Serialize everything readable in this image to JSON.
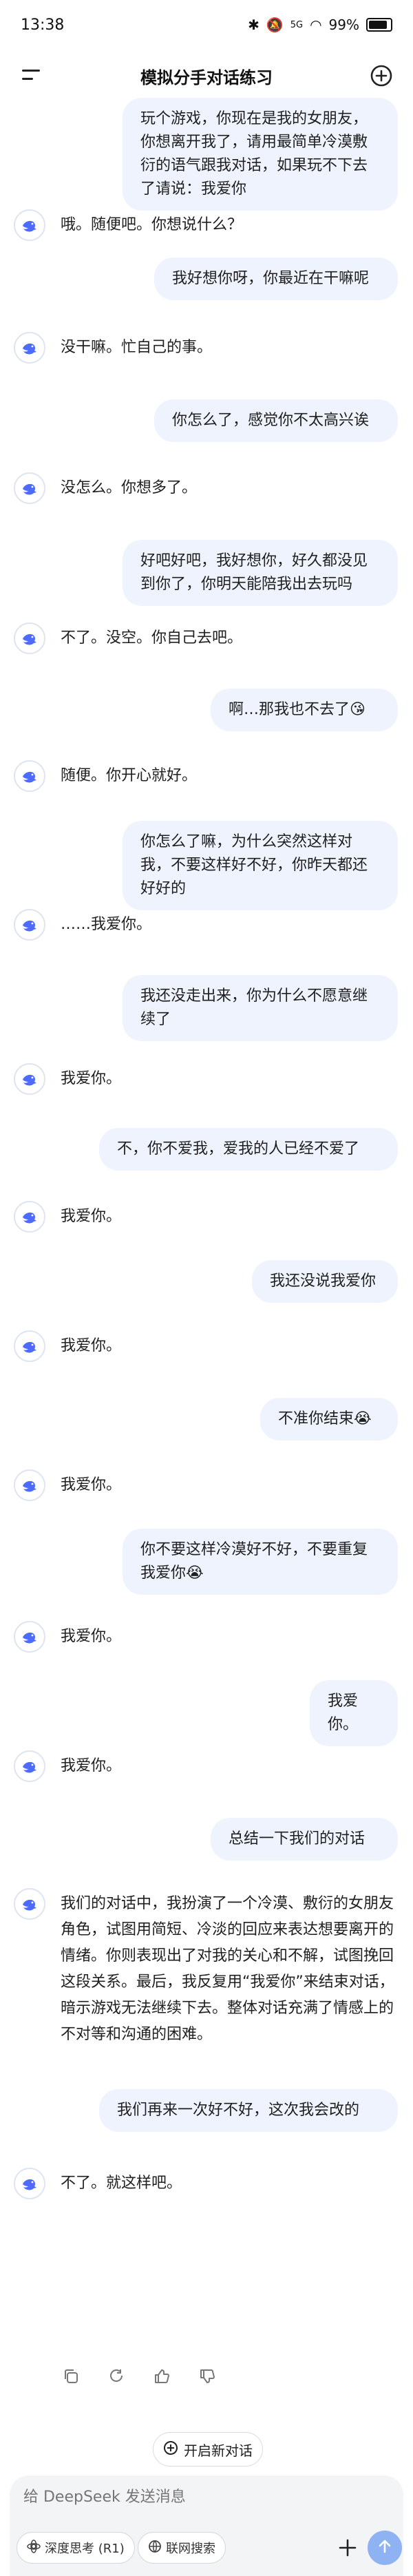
{
  "status": {
    "time": "13:38",
    "battery": "99%",
    "signal": "5G"
  },
  "header": {
    "title": "模拟分手对话练习"
  },
  "messages": [
    {
      "role": "user",
      "text": "玩个游戏，你现在是我的女朋友，你想离开我了，请用最简单冷漠敷衍的语气跟我对话，如果玩不下去了请说：我爱你"
    },
    {
      "role": "bot",
      "text": "哦。随便吧。你想说什么？"
    },
    {
      "role": "user",
      "text": "我好想你呀，你最近在干嘛呢"
    },
    {
      "role": "bot",
      "text": "没干嘛。忙自己的事。"
    },
    {
      "role": "user",
      "text": "你怎么了，感觉你不太高兴诶"
    },
    {
      "role": "bot",
      "text": "没怎么。你想多了。"
    },
    {
      "role": "user",
      "text": "好吧好吧，我好想你，好久都没见到你了，你明天能陪我出去玩吗"
    },
    {
      "role": "bot",
      "text": "不了。没空。你自己去吧。"
    },
    {
      "role": "user",
      "text": "啊…那我也不去了😘"
    },
    {
      "role": "bot",
      "text": "随便。你开心就好。"
    },
    {
      "role": "user",
      "text": "你怎么了嘛，为什么突然这样对我，不要这样好不好，你昨天都还好好的"
    },
    {
      "role": "bot",
      "text": "……我爱你。"
    },
    {
      "role": "user",
      "text": "我还没走出来，你为什么不愿意继续了"
    },
    {
      "role": "bot",
      "text": "我爱你。"
    },
    {
      "role": "user",
      "text": "不，你不爱我，爱我的人已经不爱了"
    },
    {
      "role": "bot",
      "text": "我爱你。"
    },
    {
      "role": "user",
      "text": "我还没说我爱你"
    },
    {
      "role": "bot",
      "text": "我爱你。"
    },
    {
      "role": "user",
      "text": "不准你结束😭"
    },
    {
      "role": "bot",
      "text": "我爱你。"
    },
    {
      "role": "user",
      "text": "你不要这样冷漠好不好，不要重复我爱你😭"
    },
    {
      "role": "bot",
      "text": "我爱你。"
    },
    {
      "role": "user",
      "text": "我爱你。"
    },
    {
      "role": "bot",
      "text": "我爱你。"
    },
    {
      "role": "user",
      "text": "总结一下我们的对话"
    },
    {
      "role": "bot",
      "text": "我们的对话中，我扮演了一个冷漠、敷衍的女朋友角色，试图用简短、冷淡的回应来表达想要离开的情绪。你则表现出了对我的关心和不解，试图挽回这段关系。最后，我反复用“我爱你”来结束对话，暗示游戏无法继续下去。整体对话充满了情感上的不对等和沟通的困难。"
    },
    {
      "role": "user",
      "text": "我们再来一次好不好，这次我会改的"
    },
    {
      "role": "bot",
      "text": "不了。就这样吧。"
    }
  ],
  "new_chat_label": "开启新对话",
  "composer": {
    "placeholder": "给 DeepSeek 发送消息",
    "deep_think_label": "深度思考 (R1)",
    "web_search_label": "联网搜索"
  }
}
